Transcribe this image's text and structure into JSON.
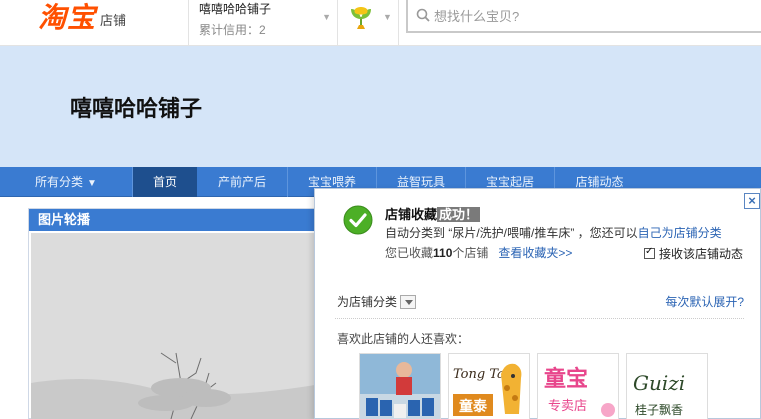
{
  "topbar": {
    "logo_main": "淘宝",
    "logo_sub": "店铺",
    "shop_name": "嘻嘻哈哈铺子",
    "shop_credit": "累计信用：2",
    "search_placeholder": "想找什么宝贝?"
  },
  "banner": {
    "title": "嘻嘻哈哈铺子"
  },
  "nav": {
    "items": [
      {
        "label": "所有分类"
      },
      {
        "label": "首页"
      },
      {
        "label": "产前产后"
      },
      {
        "label": "宝宝喂养"
      },
      {
        "label": "益智玩具"
      },
      {
        "label": "宝宝起居"
      },
      {
        "label": "店铺动态"
      }
    ],
    "dropdown_arrow": "▼"
  },
  "carousel": {
    "title": "图片轮播"
  },
  "popup": {
    "close": "×",
    "title_prefix": "店铺收藏",
    "title_highlight": "成功！",
    "line1_text": "自动分类到 “尿片/洗护/喂哺/推车床” ，您还可以",
    "line1_link": "自己为店铺分类",
    "line2_prefix": "您已收藏",
    "line2_count": "110",
    "line2_suffix": "个店铺",
    "line2_link": "查看收藏夹>>",
    "checkbox_label": "接收该店铺动态",
    "category_label": "为店铺分类",
    "expand_link": "每次默认展开?",
    "also_like": "喜欢此店铺的人还喜欢：",
    "thumbs": [
      {
        "name": "baby-photo"
      },
      {
        "name": "tongtai",
        "brand_top": "Tong Tai",
        "brand_cn": "童泰"
      },
      {
        "name": "tongbao",
        "brand_cn": "童宝",
        "brand_sub": "专卖店"
      },
      {
        "name": "guizi",
        "brand_top": "Guizi",
        "brand_cn": "桂子飘香"
      }
    ]
  },
  "colors": {
    "accent": "#3a7bd1",
    "nav_active": "#1e4f8e",
    "banner_bg": "#d5e5f8",
    "logo": "#ff5000",
    "link": "#2b64b4"
  }
}
